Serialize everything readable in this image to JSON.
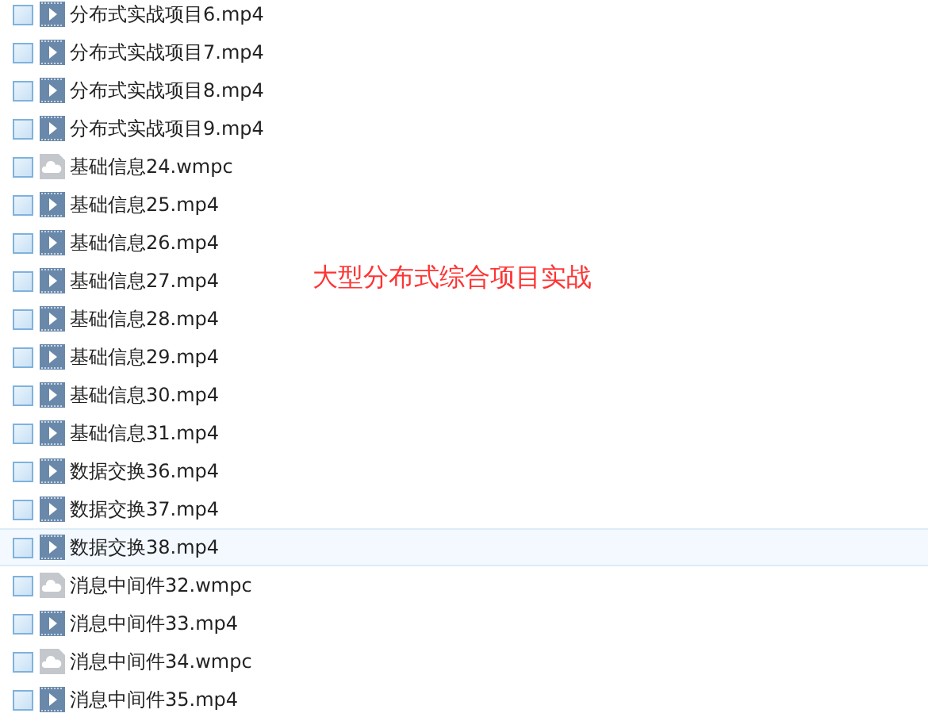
{
  "files": [
    {
      "name": "分布式实战项目6.mp4",
      "kind": "video",
      "checked": false,
      "hovered": false
    },
    {
      "name": "分布式实战项目7.mp4",
      "kind": "video",
      "checked": false,
      "hovered": false
    },
    {
      "name": "分布式实战项目8.mp4",
      "kind": "video",
      "checked": false,
      "hovered": false
    },
    {
      "name": "分布式实战项目9.mp4",
      "kind": "video",
      "checked": false,
      "hovered": false
    },
    {
      "name": "基础信息24.wmpc",
      "kind": "cloud",
      "checked": false,
      "hovered": false
    },
    {
      "name": "基础信息25.mp4",
      "kind": "video",
      "checked": false,
      "hovered": false
    },
    {
      "name": "基础信息26.mp4",
      "kind": "video",
      "checked": false,
      "hovered": false
    },
    {
      "name": "基础信息27.mp4",
      "kind": "video",
      "checked": false,
      "hovered": false
    },
    {
      "name": "基础信息28.mp4",
      "kind": "video",
      "checked": false,
      "hovered": false
    },
    {
      "name": "基础信息29.mp4",
      "kind": "video",
      "checked": false,
      "hovered": false
    },
    {
      "name": "基础信息30.mp4",
      "kind": "video",
      "checked": false,
      "hovered": false
    },
    {
      "name": "基础信息31.mp4",
      "kind": "video",
      "checked": false,
      "hovered": false
    },
    {
      "name": "数据交换36.mp4",
      "kind": "video",
      "checked": false,
      "hovered": false
    },
    {
      "name": "数据交换37.mp4",
      "kind": "video",
      "checked": false,
      "hovered": false
    },
    {
      "name": "数据交换38.mp4",
      "kind": "video",
      "checked": false,
      "hovered": true
    },
    {
      "name": "消息中间件32.wmpc",
      "kind": "cloud",
      "checked": false,
      "hovered": false
    },
    {
      "name": "消息中间件33.mp4",
      "kind": "video",
      "checked": false,
      "hovered": false
    },
    {
      "name": "消息中间件34.wmpc",
      "kind": "cloud",
      "checked": false,
      "hovered": false
    },
    {
      "name": "消息中间件35.mp4",
      "kind": "video",
      "checked": false,
      "hovered": false
    }
  ],
  "annotation": "大型分布式综合项目实战"
}
